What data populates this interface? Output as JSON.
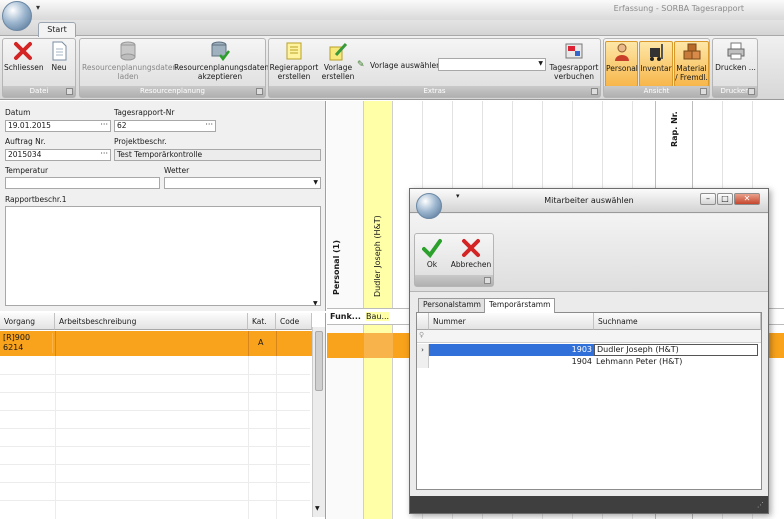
{
  "window": {
    "title": "Erfassung - SORBA Tagesrapport",
    "qa_icon": "dropdown-arrow-icon"
  },
  "tabs": [
    {
      "label": "Start"
    }
  ],
  "ribbon": {
    "groups": [
      {
        "caption": "Datei",
        "buttons": [
          {
            "label": "Schliessen",
            "icon": "close-x-icon"
          },
          {
            "label": "Neu",
            "icon": "new-document-icon"
          }
        ]
      },
      {
        "caption": "Resourcenplanung",
        "buttons": [
          {
            "label": "Resourcenplanungsdaten laden",
            "icon": "database-load-icon",
            "disabled": true
          },
          {
            "label": "Resourcenplanungsdaten akzeptieren",
            "icon": "database-accept-icon"
          }
        ]
      },
      {
        "caption": "Extras",
        "buttons": [
          {
            "label": "Regierapport erstellen",
            "icon": "report-create-icon"
          },
          {
            "label": "Vorlage erstellen",
            "icon": "template-pencil-icon"
          },
          {
            "label": "Tagesrapport verbuchen",
            "icon": "book-report-icon"
          }
        ],
        "vorlage_label": "Vorlage auswählen",
        "vorlage_value": ""
      },
      {
        "caption": "Ansicht",
        "buttons": [
          {
            "label": "Personal",
            "icon": "person-icon",
            "active": true
          },
          {
            "label": "Inventar",
            "icon": "forklift-icon",
            "active": true
          },
          {
            "label": "Material / Fremdl.",
            "icon": "boxes-icon",
            "active": true
          }
        ]
      },
      {
        "caption": "Drucken",
        "buttons": [
          {
            "label": "Drucken ...",
            "icon": "printer-icon"
          }
        ]
      }
    ]
  },
  "form": {
    "datum_label": "Datum",
    "datum_value": "19.01.2015",
    "tagesrapport_label": "Tagesrapport-Nr",
    "tagesrapport_value": "62",
    "auftrag_label": "Auftrag Nr.",
    "auftrag_value": "2015034",
    "projekt_label": "Projektbeschr.",
    "projekt_value": "Test Temporärkontrolle",
    "temperatur_label": "Temperatur",
    "temperatur_value": "",
    "wetter_label": "Wetter",
    "wetter_value": "",
    "rapport_label": "Rapportbeschr.1",
    "rapport_value": ""
  },
  "grid": {
    "headers": [
      "Vorgang",
      "Arbeitsbeschreibung",
      "Kat.",
      "Code"
    ],
    "rows": [
      {
        "vorgang": "[R]900\n6214",
        "beschreibung": "",
        "kat": "A",
        "code": ""
      }
    ]
  },
  "planner": {
    "personal_header": "Personal (1)",
    "person_name": "Dudler Joseph (H&T)",
    "rap_header": "Rap. Nr.",
    "funk_label": "Funk...",
    "bau_label": "Bau..."
  },
  "dialog": {
    "title": "Mitarbeiter auswählen",
    "buttons": [
      {
        "label": "Ok",
        "icon": "checkmark-icon"
      },
      {
        "label": "Abbrechen",
        "icon": "cancel-x-icon"
      }
    ],
    "tabs": [
      "Personalstamm",
      "Temporärstamm"
    ],
    "active_tab": "Temporärstamm",
    "columns": [
      "Nummer",
      "Suchname"
    ],
    "rows": [
      {
        "nummer": "1903",
        "suchname": "Dudler Joseph (H&T)",
        "selected": true
      },
      {
        "nummer": "1904",
        "suchname": "Lehmann Peter (H&T)",
        "selected": false
      }
    ]
  },
  "colors": {
    "highlight_orange": "#f9a21b",
    "selected_blue": "#3070d8",
    "person_yellow": "#ffffa8",
    "ansicht_active": "#f7b64b"
  }
}
